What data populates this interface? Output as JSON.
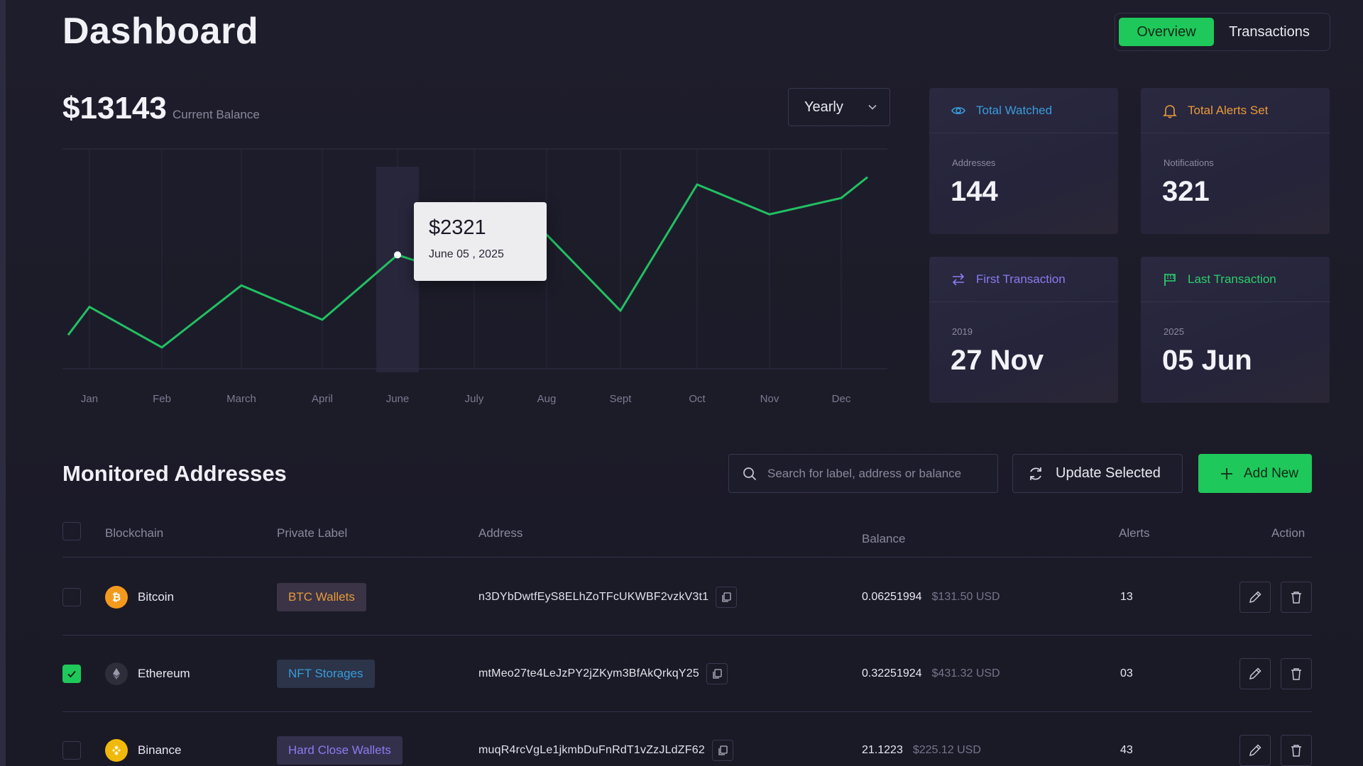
{
  "header": {
    "title": "Dashboard",
    "tabs": [
      {
        "label": "Overview",
        "active": true
      },
      {
        "label": "Transactions",
        "active": false
      }
    ]
  },
  "balance": {
    "value": "$13143",
    "label": "Current Balance",
    "period": "Yearly"
  },
  "chart_data": {
    "type": "line",
    "categories": [
      "Jan",
      "Feb",
      "March",
      "April",
      "June",
      "July",
      "Aug",
      "Sept",
      "Oct",
      "Nov",
      "Dec"
    ],
    "values": [
      1400,
      680,
      1780,
      1170,
      2321,
      1880,
      2680,
      1330,
      3570,
      3040,
      3330
    ],
    "ylim": [
      300,
      4200
    ],
    "grid": true,
    "line_color": "#22c063",
    "tooltip": {
      "value": "$2321",
      "date": "June 05 , 2025"
    }
  },
  "stats": [
    {
      "title": "Total Watched",
      "sub": "Addresses",
      "value": "144",
      "icon": "eye-icon",
      "color": "#3a9bdc"
    },
    {
      "title": "Total Alerts Set",
      "sub": "Notifications",
      "value": "321",
      "icon": "bell-icon",
      "color": "#e89a3a"
    },
    {
      "title": "First Transaction",
      "sub": "2019",
      "value": "27 Nov",
      "icon": "transfer-icon",
      "color": "#8a7cf0"
    },
    {
      "title": "Last Transaction",
      "sub": "2025",
      "value": "05 Jun",
      "icon": "flag-icon",
      "color": "#2ccf6c"
    }
  ],
  "addresses": {
    "title": "Monitored Addresses",
    "search_placeholder": "Search for label, address or balance",
    "update_label": "Update Selected",
    "add_label": "Add New",
    "columns": [
      "Blockchain",
      "Private Label",
      "Address",
      "Balance",
      "Alerts",
      "Action"
    ],
    "rows": [
      {
        "chain": "Bitcoin",
        "label": "BTC Wallets",
        "label_color": "#e89a3a",
        "address": "n3DYbDwtfEyS8ELhZoTFcUKWBF2vzkV3t1",
        "balance": "0.06251994",
        "usd": "$131.50 USD",
        "alerts": "13",
        "checked": false,
        "icon": "bitcoin-icon"
      },
      {
        "chain": "Ethereum",
        "label": "NFT Storages",
        "label_color": "#3a9bdc",
        "address": "mtMeo27te4LeJzPY2jZKym3BfAkQrkqY25",
        "balance": "0.32251924",
        "usd": "$431.32 USD",
        "alerts": "03",
        "checked": true,
        "icon": "ethereum-icon"
      },
      {
        "chain": "Binance",
        "label": "Hard Close Wallets",
        "label_color": "#8a7cf0",
        "address": "muqR4rcVgLe1jkmbDuFnRdT1vZzJLdZF62",
        "balance": "21.1223",
        "usd": "$225.12 USD",
        "alerts": "43",
        "checked": false,
        "icon": "binance-icon"
      }
    ]
  }
}
